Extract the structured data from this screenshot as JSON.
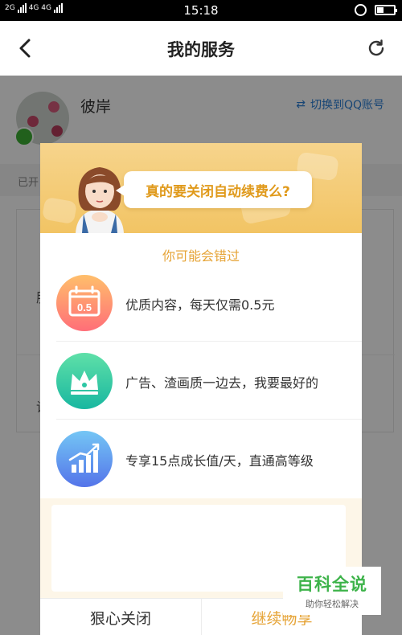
{
  "status_bar": {
    "network_1": "2G",
    "network_2": "4G 4G",
    "time": "15:18"
  },
  "header": {
    "title": "我的服务"
  },
  "profile": {
    "username": "彼岸",
    "switch_label": "切换到QQ账号"
  },
  "background_page": {
    "stripe_text": "已开",
    "card_fragment_1": "服",
    "card_fragment_2": "请"
  },
  "dialog": {
    "bubble_text": "真的要关闭自动续费么?",
    "subheading": "你可能会错过",
    "items": [
      {
        "icon": "calendar-05-icon",
        "badge_text": "0.5",
        "label": "优质内容，每天仅需0.5元"
      },
      {
        "icon": "crown-icon",
        "label": "广告、渣画质一边去，我要最好的"
      },
      {
        "icon": "growth-chart-icon",
        "label": "专享15点成长值/天，直通高等级"
      }
    ],
    "buttons": {
      "close": "狠心关闭",
      "continue": "继续畅享"
    }
  },
  "watermark": {
    "title": "百科全说",
    "subtitle": "助你轻松解决"
  },
  "colors": {
    "accent_gold": "#e6a437",
    "link_blue": "#2a7fd6",
    "watermark_green": "#3db34a"
  }
}
